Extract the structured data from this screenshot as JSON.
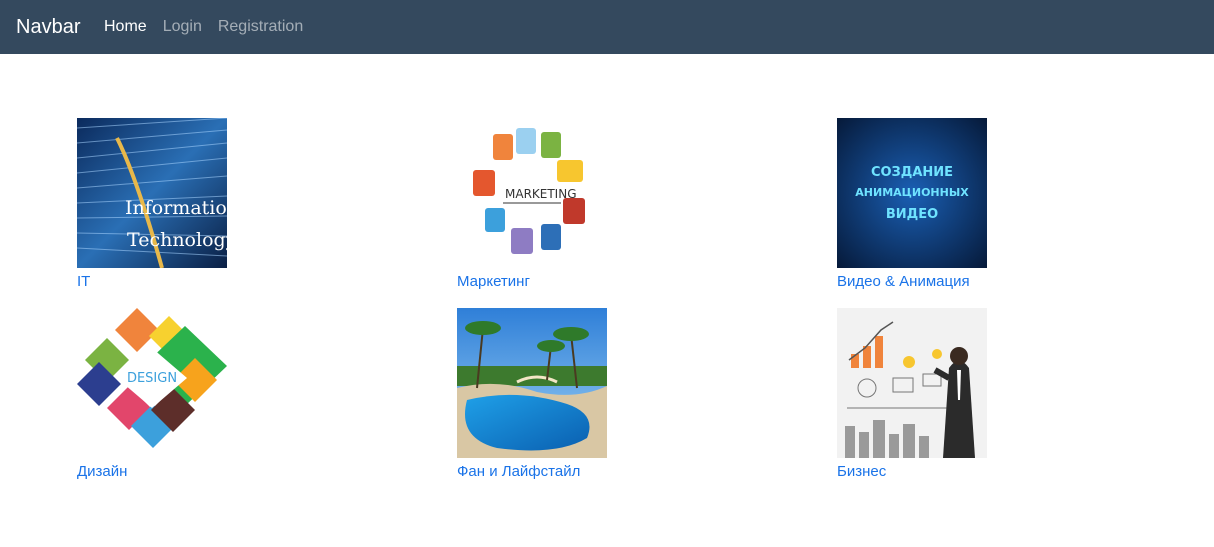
{
  "navbar": {
    "brand": "Navbar",
    "links": [
      {
        "label": "Home",
        "active": true
      },
      {
        "label": "Login",
        "active": false
      },
      {
        "label": "Registration",
        "active": false
      }
    ]
  },
  "categories": [
    {
      "title": "IT",
      "image_text": [
        "Information",
        "Technology"
      ]
    },
    {
      "title": "Маркетинг",
      "image_text": [
        "MARKETING"
      ]
    },
    {
      "title": "Видео & Анимация",
      "image_text": [
        "СОЗДАНИЕ",
        "АНИМАЦИОННЫХ",
        "ВИДЕО"
      ]
    },
    {
      "title": "Дизайн",
      "image_text": [
        "DESIGN"
      ]
    },
    {
      "title": "Фан и Лайфстайл",
      "image_text": []
    },
    {
      "title": "Бизнес",
      "image_text": []
    }
  ],
  "colors": {
    "navbar_bg": "#34495e",
    "link": "#1a73e8"
  }
}
